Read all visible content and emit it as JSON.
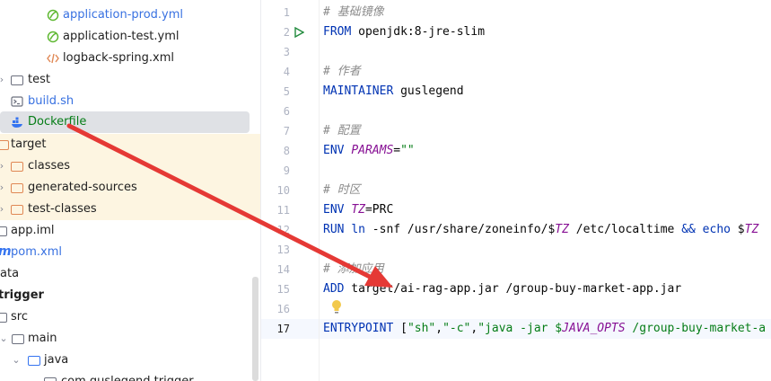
{
  "tree": {
    "items": [
      {
        "label": "application-prod.yml",
        "icon": "spring-leaf-icon",
        "color": "blue"
      },
      {
        "label": "application-test.yml",
        "icon": "spring-leaf-icon",
        "color": "normal"
      },
      {
        "label": "logback-spring.xml",
        "icon": "xml-icon",
        "color": "normal"
      },
      {
        "label": "test",
        "icon": "folder-icon",
        "color": "normal"
      },
      {
        "label": "build.sh",
        "icon": "shell-icon",
        "color": "blue"
      },
      {
        "label": "Dockerfile",
        "icon": "docker-icon",
        "color": "green"
      },
      {
        "label": "target",
        "icon": "folder-icon",
        "color": "normal"
      },
      {
        "label": "classes",
        "icon": "folder-icon",
        "color": "normal"
      },
      {
        "label": "generated-sources",
        "icon": "folder-icon",
        "color": "normal"
      },
      {
        "label": "test-classes",
        "icon": "folder-icon",
        "color": "normal"
      },
      {
        "label": "app.iml",
        "icon": "iml-icon",
        "color": "normal"
      },
      {
        "label": "pom.xml",
        "icon": "maven-icon",
        "color": "blue"
      },
      {
        "label": "ata",
        "icon": "none",
        "color": "normal"
      },
      {
        "label": "trigger",
        "icon": "none",
        "color": "bold"
      },
      {
        "label": "src",
        "icon": "folder-icon",
        "color": "normal"
      },
      {
        "label": "main",
        "icon": "folder-icon",
        "color": "normal"
      },
      {
        "label": "java",
        "icon": "folder-icon",
        "color": "normal"
      },
      {
        "label": "com.guslegend.trigger",
        "icon": "package-icon",
        "color": "normal"
      }
    ]
  },
  "editor": {
    "line_numbers": [
      "1",
      "2",
      "3",
      "4",
      "5",
      "6",
      "7",
      "8",
      "9",
      "10",
      "11",
      "12",
      "13",
      "14",
      "15",
      "16",
      "17"
    ],
    "lines": {
      "l1_comment": "# 基础镜像",
      "l2_kw": "FROM",
      "l2_rest": " openjdk:8-jre-slim",
      "l4_comment": "# 作者",
      "l5_kw": "MAINTAINER",
      "l5_rest": " guslegend",
      "l7_comment": "# 配置",
      "l8_kw": "ENV",
      "l8_var": "PARAMS",
      "l8_eq": "=",
      "l8_str": "\"\"",
      "l10_comment": "# 时区",
      "l11_kw": "ENV",
      "l11_var": "TZ",
      "l11_rest": "=PRC",
      "l12_kw": "RUN",
      "l12_a": " ",
      "l12_ln": "ln",
      "l12_b": " -snf /usr/share/zoneinfo/$",
      "l12_tz1": "TZ",
      "l12_c": " /etc/localtime ",
      "l12_and": "&&",
      "l12_d": " ",
      "l12_echo": "echo",
      "l12_e": " $",
      "l12_tz2": "TZ",
      "l14_comment": "# 添加应用",
      "l15_kw": "ADD",
      "l15_rest": " target/ai-rag-app.jar /group-buy-market-app.jar",
      "l17_kw": "ENTRYPOINT",
      "l17_a": " [",
      "l17_s1": "\"sh\"",
      "l17_c1": ",",
      "l17_s2": "\"-c\"",
      "l17_c2": ",",
      "l17_s3": "\"java -jar $",
      "l17_v": "JAVA_OPTS",
      "l17_s4": " /group-buy-market-a"
    }
  },
  "colors": {
    "annotation_arrow": "#e53935",
    "excluded_bg": "#fdf5e1",
    "selected_bg": "#dfe1e5"
  }
}
